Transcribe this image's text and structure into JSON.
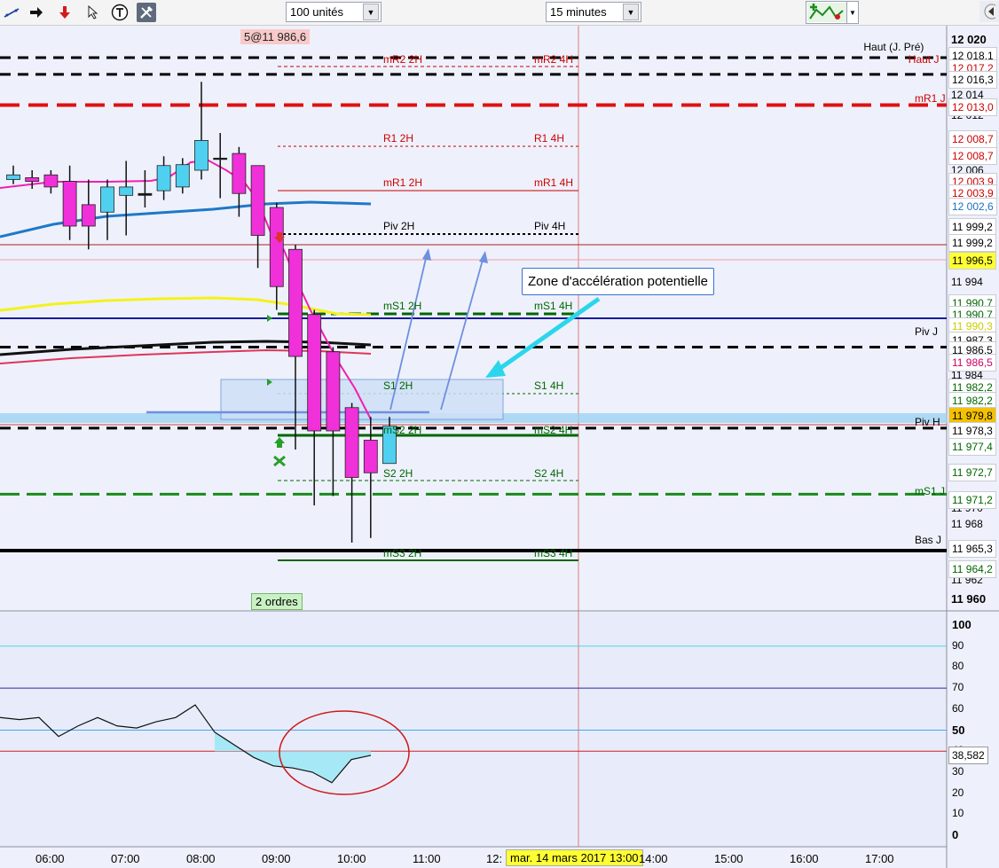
{
  "toolbar": {
    "quantity": "100 unités",
    "timeframe": "15 minutes"
  },
  "chart_data": {
    "type": "candlestick",
    "x_axis": [
      "06:00",
      "07:00",
      "08:00",
      "09:00",
      "10:00",
      "11:00",
      "12:00",
      "13:00",
      "14:00",
      "15:00",
      "16:00",
      "17:00"
    ],
    "y_axis": {
      "min": 11960,
      "max": 12020,
      "ticks": [
        "12 020",
        "12 014",
        "12 012",
        "12 006",
        "11 994",
        "11 984",
        "11 970",
        "11 968",
        "11 962",
        "11 960"
      ]
    },
    "candles": [
      {
        "o": 12005.0,
        "h": 12006.5,
        "c": 12005.5,
        "l": 12004.5,
        "dir": "up"
      },
      {
        "o": 12005.2,
        "h": 12006.0,
        "c": 12004.8,
        "l": 12004.0,
        "dir": "down"
      },
      {
        "o": 12005.5,
        "h": 12006.0,
        "c": 12004.2,
        "l": 12003.5,
        "dir": "down"
      },
      {
        "o": 12004.8,
        "h": 12006.5,
        "c": 12000.0,
        "l": 11998.5,
        "dir": "down"
      },
      {
        "o": 12000.0,
        "h": 12005.0,
        "c": 12002.3,
        "l": 11997.5,
        "dir": "down"
      },
      {
        "o": 12001.5,
        "h": 12005.0,
        "c": 12004.2,
        "l": 11998.5,
        "dir": "up"
      },
      {
        "o": 12004.2,
        "h": 12007.0,
        "c": 12003.3,
        "l": 11999.0,
        "dir": "up"
      },
      {
        "o": 12003.3,
        "h": 12006.0,
        "c": 12003.5,
        "l": 12002.0,
        "dir": "flat"
      },
      {
        "o": 12003.8,
        "h": 12007.5,
        "c": 12006.5,
        "l": 12002.8,
        "dir": "up"
      },
      {
        "o": 12004.2,
        "h": 12007.3,
        "c": 12006.6,
        "l": 12003.5,
        "dir": "up"
      },
      {
        "o": 12006.0,
        "h": 12015.5,
        "c": 12009.2,
        "l": 12005.0,
        "dir": "up"
      },
      {
        "o": 12007.3,
        "h": 12010.0,
        "c": 12007.3,
        "l": 12003.0,
        "dir": "flat"
      },
      {
        "o": 12007.8,
        "h": 12008.5,
        "c": 12003.5,
        "l": 12001.0,
        "dir": "down"
      },
      {
        "o": 12006.5,
        "h": 12006.5,
        "c": 11999.0,
        "l": 11995.5,
        "dir": "down"
      },
      {
        "o": 12002.0,
        "h": 12002.5,
        "c": 11993.5,
        "l": 11991.0,
        "dir": "down"
      },
      {
        "o": 11997.5,
        "h": 11998.0,
        "c": 11986.0,
        "l": 11976.0,
        "dir": "down"
      },
      {
        "o": 11990.5,
        "h": 11991.0,
        "c": 11978.0,
        "l": 11970.0,
        "dir": "down"
      },
      {
        "o": 11986.5,
        "h": 11987.0,
        "c": 11978.0,
        "l": 11971.0,
        "dir": "down"
      },
      {
        "o": 11980.5,
        "h": 11981.0,
        "c": 11973.0,
        "l": 11966.0,
        "dir": "down"
      },
      {
        "o": 11977.0,
        "h": 11979.5,
        "c": 11973.5,
        "l": 11966.5,
        "dir": "down"
      },
      {
        "o": 11974.5,
        "h": 11979.5,
        "c": 11978.5,
        "l": 11974.5,
        "dir": "up"
      }
    ],
    "price_tags": [
      {
        "text": "Haut (J. Pré)",
        "value": "12 018,1",
        "color": "#000000",
        "bg": "#ffffff"
      },
      {
        "text": "Haut J",
        "value": "12 017,2",
        "color": "#cc0000",
        "bg": "#ffffff"
      },
      {
        "text": "",
        "value": "12 016,3",
        "color": "#000000",
        "bg": "#ffffff"
      },
      {
        "text": "mR1 J",
        "value": "12 013,0",
        "color": "#cc0000",
        "bg": "#ffffff"
      },
      {
        "text": "",
        "value": "12 008,7",
        "color": "#cc0000",
        "bg": "#ffffff"
      },
      {
        "text": "",
        "value": "12 008,7",
        "color": "#cc0000",
        "bg": "#ffffff"
      },
      {
        "text": "",
        "value": "12 003,9",
        "color": "#cc0000",
        "bg": "#ffffff"
      },
      {
        "text": "",
        "value": "12 003,9",
        "color": "#cc0000",
        "bg": "#ffffff"
      },
      {
        "text": "",
        "value": "12 002,6",
        "color": "#1a6fc0",
        "bg": "#ffffff"
      },
      {
        "text": "",
        "value": "11 999,2",
        "color": "#000000",
        "bg": "#ffffff"
      },
      {
        "text": "",
        "value": "11 999,2",
        "color": "#000000",
        "bg": "#ffffff"
      },
      {
        "text": "",
        "value": "11 996,5",
        "color": "#000000",
        "bg": "#ffff33"
      },
      {
        "text": "",
        "value": "11 990,7",
        "color": "#006600",
        "bg": "#ffffff"
      },
      {
        "text": "",
        "value": "11 990,7",
        "color": "#006600",
        "bg": "#ffffff"
      },
      {
        "text": "",
        "value": "11 990,3",
        "color": "#cccc00",
        "bg": "#ffffff"
      },
      {
        "text": "Piv J",
        "value": "11 987,3",
        "color": "#000000",
        "bg": "#ffffff"
      },
      {
        "text": "",
        "value": "11 986,5",
        "color": "#000000",
        "bg": "#ffffff"
      },
      {
        "text": "",
        "value": "11 986,5",
        "color": "#cc0066",
        "bg": "#ffffff"
      },
      {
        "text": "",
        "value": "11 982,2",
        "color": "#006600",
        "bg": "#ffffff"
      },
      {
        "text": "",
        "value": "11 982,2",
        "color": "#006600",
        "bg": "#ffffff"
      },
      {
        "text": "",
        "value": "11 979,8",
        "color": "#000000",
        "bg": "#f3c100"
      },
      {
        "text": "Piv H",
        "value": "11 978,3",
        "color": "#000000",
        "bg": "#ffffff"
      },
      {
        "text": "",
        "value": "11 977,4",
        "color": "#006600",
        "bg": "#ffffff"
      },
      {
        "text": "",
        "value": "11 972,7",
        "color": "#006600",
        "bg": "#ffffff"
      },
      {
        "text": "mS1 J",
        "value": "11 971,2",
        "color": "#006600",
        "bg": "#ffffff"
      },
      {
        "text": "Bas J",
        "value": "11 965,3",
        "color": "#000000",
        "bg": "#ffffff"
      },
      {
        "text": "",
        "value": "11 964,2",
        "color": "#006600",
        "bg": "#ffffff"
      }
    ],
    "levels_2h_4h": [
      {
        "name2h": "mR2 2H",
        "name4h": "mR2 4H",
        "color": "#cc0000"
      },
      {
        "name2h": "R1 2H",
        "name4h": "R1 4H",
        "color": "#cc0000"
      },
      {
        "name2h": "mR1 2H",
        "name4h": "mR1 4H",
        "color": "#cc0000"
      },
      {
        "name2h": "Piv 2H",
        "name4h": "Piv 4H",
        "color": "#000000"
      },
      {
        "name2h": "mS1 2H",
        "name4h": "mS1 4H",
        "color": "#006600"
      },
      {
        "name2h": "S1 2H",
        "name4h": "S1 4H",
        "color": "#006600"
      },
      {
        "name2h": "mS2 2H",
        "name4h": "mS2 4H",
        "color": "#006600"
      },
      {
        "name2h": "S2 2H",
        "name4h": "S2 4H",
        "color": "#006600"
      },
      {
        "name2h": "mS3 2H",
        "name4h": "mS3 4H",
        "color": "#006600"
      }
    ],
    "oscillator": {
      "y_ticks": [
        "100",
        "90",
        "80",
        "70",
        "60",
        "50",
        "40",
        "30",
        "20",
        "10",
        "0"
      ],
      "current": "38,582",
      "values": [
        56,
        55,
        56,
        47,
        52,
        56,
        52,
        51,
        54,
        56,
        62,
        49,
        43,
        37,
        33,
        32,
        30,
        25,
        36,
        38
      ]
    }
  },
  "annotations": {
    "order_tag": "5@11 986,6",
    "orders_badge": "2 ordres",
    "zone_label": "Zone d'accélération potentielle",
    "crosshair_date": "mar. 14 mars 2017 13:00"
  }
}
